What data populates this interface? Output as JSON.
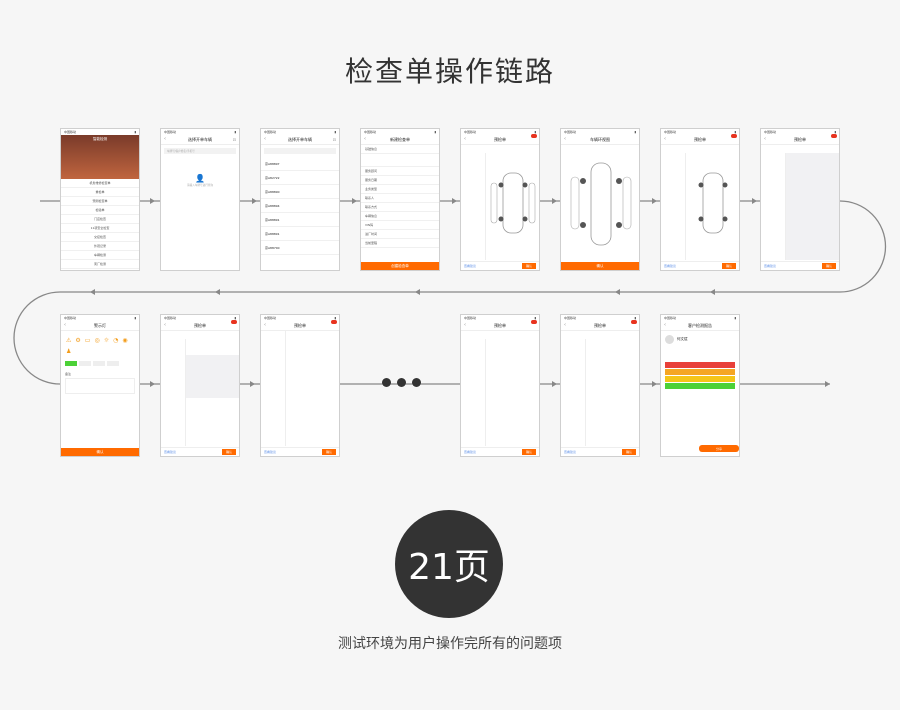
{
  "title": "检查单操作链路",
  "badge": "21页",
  "subtitle": "测试环境为用户操作完所有的问题项",
  "colors": {
    "accent": "#ff6a00",
    "line": "#888888",
    "dark": "#333333"
  },
  "screens": {
    "s1": {
      "status": "中国移动",
      "title": "智能检测",
      "items": [
        "机务维修检查单",
        "重检单",
        "预测检查单",
        "检验单",
        "门店检查",
        "11项安全检查",
        "交接检查",
        "外观记录",
        "车辆检测",
        "离厂检测",
        "车辆"
      ]
    },
    "s2": {
      "status": "中国移动",
      "title": "选择开单车辆",
      "search": "车牌号/客户姓名/手机号",
      "hint": "请输入车牌号进行查询"
    },
    "s3": {
      "status": "中国移动",
      "title": "选择开单车辆",
      "plates": [
        "京A88897",
        "京A82722",
        "京A88890",
        "京A88894",
        "京A88891",
        "京A88891",
        "京A88700"
      ]
    },
    "s4": {
      "status": "中国移动",
      "title": "新建检查单",
      "fields": [
        "基础信息",
        "服务顾问",
        "服务日期",
        "业务类型",
        "联系人",
        "联系方式",
        "车辆信息",
        "VIN码",
        "进厂时间",
        "当前里程"
      ],
      "button": "创建检查单"
    },
    "s5": {
      "status": "中国移动",
      "title": "预检单",
      "bottom_left": "查看建议",
      "bottom_right": "确认"
    },
    "s6": {
      "status": "中国移动",
      "title": "车辆环视图",
      "button": "确认"
    },
    "s7": {
      "status": "中国移动",
      "title": "预检单",
      "bottom_left": "查看建议",
      "bottom_right": "确认"
    },
    "s8": {
      "status": "中国移动",
      "title": "预检单",
      "bottom_left": "查看建议",
      "bottom_right": "确认"
    },
    "s9": {
      "status": "中国移动",
      "title": "警示灯",
      "section": "备注",
      "button": "确认"
    },
    "s10": {
      "status": "中国移动",
      "title": "预检单",
      "bottom_left": "查看建议",
      "bottom_right": "确认"
    },
    "s11": {
      "status": "中国移动",
      "title": "预检单",
      "bottom_left": "查看建议",
      "bottom_right": "确认"
    },
    "s12": {
      "status": "中国移动",
      "title": "预检单",
      "bottom_left": "查看建议",
      "bottom_right": "确认"
    },
    "s13": {
      "status": "中国移动",
      "title": "预检单",
      "bottom_left": "查看建议",
      "bottom_right": "确认"
    },
    "s14": {
      "status": "中国移动",
      "title": "客户检测报告",
      "name": "何文斌",
      "button": "分享"
    }
  }
}
